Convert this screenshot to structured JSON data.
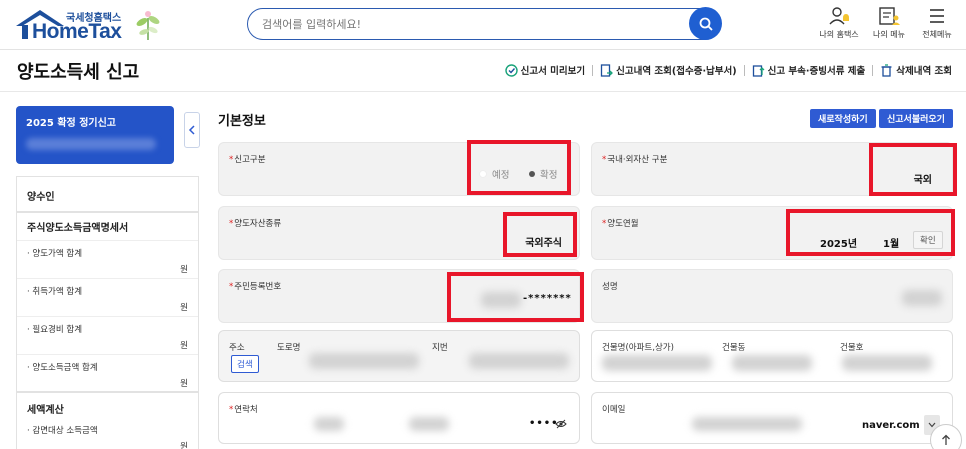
{
  "header": {
    "logo_small": "국세청홈택스",
    "logo_big": "HomeTax",
    "search_placeholder": "검색어를 입력하세요!",
    "menus": {
      "my_hometax": "나의 홈택스",
      "my_menu": "나의 메뉴",
      "all_menu": "전체메뉴"
    }
  },
  "page": {
    "title": "양도소득세 신고",
    "links": {
      "preview": "신고서 미리보기",
      "history": "신고내역 조회(접수증·납부서)",
      "attach": "신고 부속·증빙서류 제출",
      "deleted": "삭제내역 조회"
    }
  },
  "left": {
    "season": "2025 확정 정기신고",
    "transferee": "양수인",
    "stock_section": {
      "title": "주식양도소득금액명세서",
      "items": [
        {
          "label": "· 양도가액 합계",
          "unit": "원"
        },
        {
          "label": "· 취득가액 합계",
          "unit": "원"
        },
        {
          "label": "· 필요경비 합계",
          "unit": "원"
        },
        {
          "label": "· 양도소득금액 합계",
          "unit": "원"
        }
      ]
    },
    "tax_section": {
      "title": "세액계산",
      "items": [
        {
          "label": "· 감면대상 소득금액",
          "unit": "원"
        }
      ]
    }
  },
  "main": {
    "title": "기본정보",
    "btn_new": "새로작성하기",
    "btn_load": "신고서불러오기",
    "fields": {
      "report_type": {
        "label": "신고구분",
        "opt1": "예정",
        "opt2": "확정"
      },
      "domestic": {
        "label": "국내·외자산 구분",
        "value": "국외"
      },
      "asset_type": {
        "label": "양도자산종류",
        "value": "국외주식"
      },
      "transfer_date": {
        "label": "양도연월",
        "year": "2025년",
        "month": "1월",
        "confirm": "확인"
      },
      "resident_no": {
        "label": "주민등록번호",
        "masked": "-*******"
      },
      "name": {
        "label": "성명"
      },
      "address": {
        "label": "주소",
        "road": "도로명",
        "lot": "지번",
        "search_btn": "검색"
      },
      "building": {
        "name": "건물명(아파트,상가)",
        "dong": "건물동",
        "ho": "건물호"
      },
      "contact": {
        "label": "연락처",
        "masked": "••••"
      },
      "email": {
        "label": "이메일",
        "domain": "naver.com"
      }
    }
  },
  "colors": {
    "brand": "#1d4f9c",
    "accent": "#2f5bd3",
    "highlight": "#e8162a"
  }
}
